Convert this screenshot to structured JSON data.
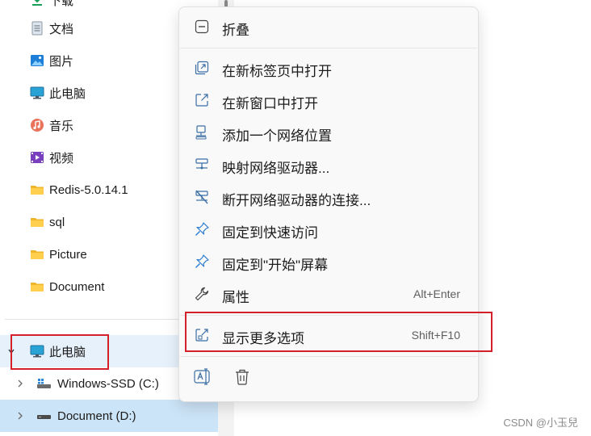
{
  "nav": {
    "items": [
      {
        "label": "下载",
        "icon": "download-icon"
      },
      {
        "label": "文档",
        "icon": "document-icon"
      },
      {
        "label": "图片",
        "icon": "pictures-icon"
      },
      {
        "label": "此电脑",
        "icon": "computer-icon"
      },
      {
        "label": "音乐",
        "icon": "music-icon"
      },
      {
        "label": "视频",
        "icon": "video-icon"
      },
      {
        "label": "Redis-5.0.14.1",
        "icon": "folder-icon"
      },
      {
        "label": "sql",
        "icon": "folder-icon"
      },
      {
        "label": "Picture",
        "icon": "folder-icon"
      },
      {
        "label": "Document",
        "icon": "folder-icon"
      }
    ],
    "tree": [
      {
        "label": "此电脑",
        "icon": "computer-icon",
        "expanded": true
      },
      {
        "label": "Windows-SSD (C:)",
        "icon": "windows-drive-icon",
        "expanded": false
      },
      {
        "label": "Document (D:)",
        "icon": "drive-icon",
        "expanded": false
      }
    ]
  },
  "menu": {
    "items": [
      {
        "label": "折叠",
        "icon": "collapse-icon"
      },
      {
        "label": "在新标签页中打开",
        "icon": "new-tab-icon"
      },
      {
        "label": "在新窗口中打开",
        "icon": "new-window-icon"
      },
      {
        "label": "添加一个网络位置",
        "icon": "network-location-icon"
      },
      {
        "label": "映射网络驱动器...",
        "icon": "map-network-drive-icon"
      },
      {
        "label": "断开网络驱动器的连接...",
        "icon": "disconnect-network-drive-icon"
      },
      {
        "label": "固定到快速访问",
        "icon": "pin-icon"
      },
      {
        "label": "固定到\"开始\"屏幕",
        "icon": "pin-icon"
      },
      {
        "label": "属性",
        "icon": "wrench-icon",
        "shortcut": "Alt+Enter"
      },
      {
        "label": "显示更多选项",
        "icon": "more-options-icon",
        "shortcut": "Shift+F10"
      }
    ],
    "bottom_buttons": [
      {
        "icon": "rename-icon"
      },
      {
        "icon": "delete-icon"
      }
    ]
  },
  "colors": {
    "accent": "#0067c0",
    "highlight_box": "#d4202a",
    "selected_row": "#cce4f7"
  },
  "watermark": "CSDN @小玉兒"
}
